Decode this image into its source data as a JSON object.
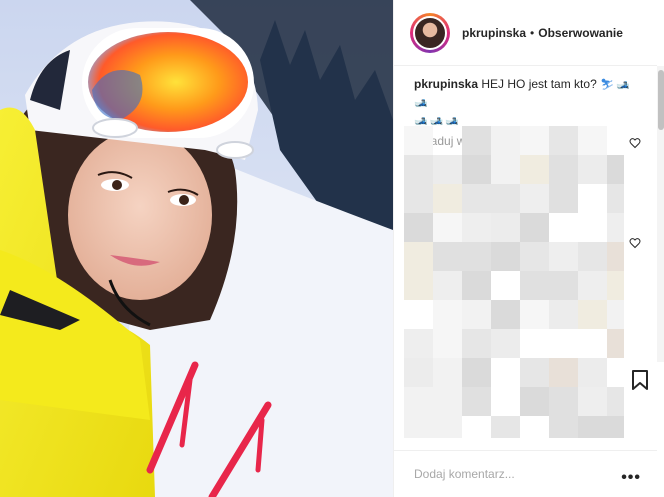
{
  "header": {
    "username": "pkrupinska",
    "separator": "•",
    "follow_label": "Obserwowanie"
  },
  "caption": {
    "username": "pkrupinska",
    "text": "HEJ HO jest tam kto?"
  },
  "load_more_label": "Załaduj więcej komentarzy",
  "comment_input": {
    "placeholder": "Dodaj komentarz..."
  },
  "icons": {
    "like": "heart-icon",
    "save": "bookmark-icon",
    "more": "more-options-icon",
    "emoji": "ski-emoji"
  },
  "colors": {
    "jacket": "#f4ea1c",
    "ski_poles": "#e8264a",
    "avatar_ring": "#dd2a7b",
    "muted_text": "#999999"
  }
}
